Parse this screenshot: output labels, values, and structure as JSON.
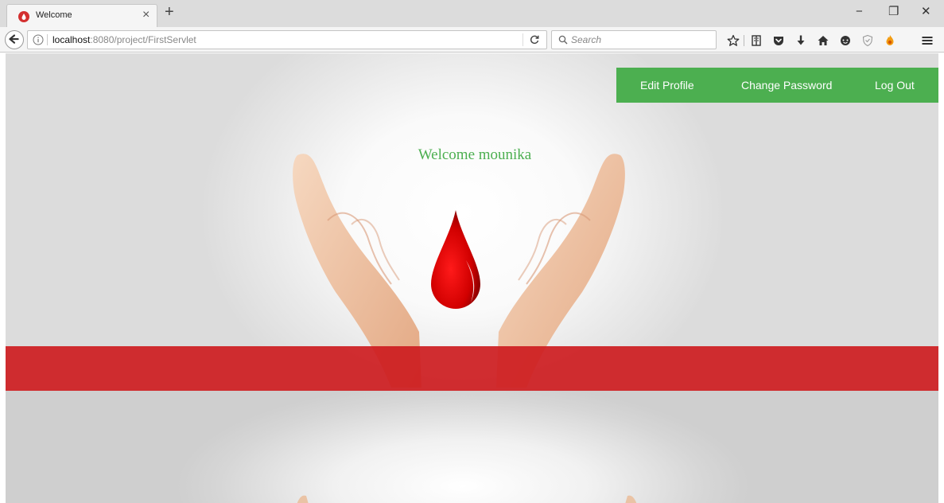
{
  "browser": {
    "tab_title": "Welcome",
    "tab_close": "×",
    "new_tab": "+",
    "window_controls": {
      "minimize": "−",
      "restore": "❐",
      "close": "✕"
    },
    "url_host": "localhost",
    "url_rest": ":8080/project/FirstServlet",
    "search_placeholder": "Search",
    "toolbar_icons": [
      "bookmark-star-icon",
      "reading-list-icon",
      "pocket-icon",
      "download-icon",
      "home-icon",
      "chat-icon",
      "shield-icon",
      "extension-icon",
      "hamburger-menu-icon"
    ]
  },
  "page": {
    "nav": {
      "edit_profile": "Edit Profile",
      "change_password": "Change Password",
      "log_out": "Log Out"
    },
    "welcome_text": "Welcome mounika"
  },
  "colors": {
    "nav_green": "#4caf50",
    "welcome_green": "#4caf50",
    "band_red": "#cd1c20",
    "drop_red": "#d10000"
  }
}
